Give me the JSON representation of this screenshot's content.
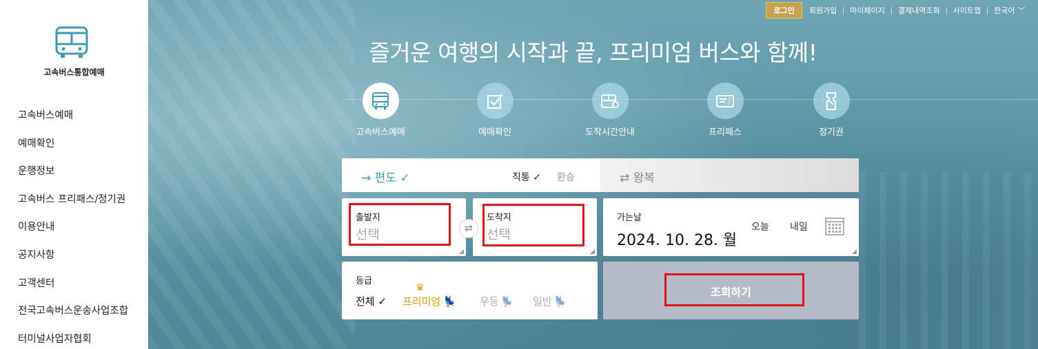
{
  "sidebar": {
    "logo_text": "고속버스통합예매",
    "items": [
      {
        "label": "고속버스예매"
      },
      {
        "label": "예매확인"
      },
      {
        "label": "운행정보"
      },
      {
        "label": "고속버스 프리패스/정기권"
      },
      {
        "label": "이용안내"
      },
      {
        "label": "공지사항"
      },
      {
        "label": "고객센터"
      },
      {
        "label": "전국고속버스운송사업조합"
      },
      {
        "label": "터미널사업자협회"
      }
    ]
  },
  "topnav": {
    "login": "로그인",
    "links": [
      "회원가입",
      "마이페이지",
      "결제내역조회",
      "사이트맵",
      "한국어"
    ]
  },
  "headline": "즐거운 여행의 시작과 끝, 프리미엄 버스와 함께!",
  "services": [
    {
      "label": "고속버스예매",
      "icon": "bus-icon"
    },
    {
      "label": "예매확인",
      "icon": "checkbox-icon"
    },
    {
      "label": "도착시간안내",
      "icon": "arrival-time-icon"
    },
    {
      "label": "프리패스",
      "icon": "pass-icon"
    },
    {
      "label": "정기권",
      "icon": "season-ticket-icon"
    }
  ],
  "trip": {
    "oneway": "→ 편도 ✓",
    "direct": "직통 ✓",
    "transfer": "환승",
    "roundtrip": "⇄ 왕복"
  },
  "departure": {
    "label": "출발지",
    "value": "선택"
  },
  "arrival": {
    "label": "도착지",
    "value": "선택"
  },
  "date": {
    "label": "가는날",
    "value": "2024. 10. 28. 월",
    "today": "오늘",
    "tomorrow": "내일"
  },
  "grade": {
    "label": "등급",
    "options": [
      "전체 ✓",
      "프리미엄",
      "우등",
      "일반"
    ]
  },
  "search_button": "조회하기",
  "colors": {
    "accent": "#3e9bb3",
    "premium": "#e49a00",
    "login": "#c9a14a",
    "highlight": "#e0101a",
    "search_bg": "#b6bac6"
  }
}
